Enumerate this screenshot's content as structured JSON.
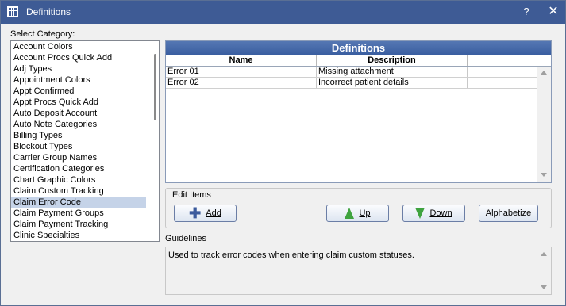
{
  "window": {
    "title": "Definitions",
    "help_label": "?",
    "close_label": "✕"
  },
  "categories": {
    "label": "Select Category:",
    "items": [
      "Account Colors",
      "Account Procs Quick Add",
      "Adj Types",
      "Appointment Colors",
      "Appt Confirmed",
      "Appt Procs Quick Add",
      "Auto Deposit Account",
      "Auto Note Categories",
      "Billing Types",
      "Blockout Types",
      "Carrier Group Names",
      "Certification Categories",
      "Chart Graphic Colors",
      "Claim Custom Tracking",
      "Claim Error Code",
      "Claim Payment Groups",
      "Claim Payment Tracking",
      "Clinic Specialties"
    ],
    "selected": "Claim Error Code"
  },
  "definitions": {
    "header": "Definitions",
    "columns": [
      "Name",
      "Description",
      "",
      ""
    ],
    "rows": [
      {
        "name": "Error 01",
        "description": "Missing attachment"
      },
      {
        "name": "Error 02",
        "description": "Incorrect patient details"
      }
    ]
  },
  "edit_items": {
    "title": "Edit Items",
    "add_label": "Add",
    "up_label": "Up",
    "down_label": "Down",
    "alphabetize_label": "Alphabetize"
  },
  "guidelines": {
    "label": "Guidelines",
    "text": "Used to track error codes when entering claim custom statuses."
  },
  "icons": {
    "app": "grid-app-icon",
    "add": "plus-icon",
    "up": "green-up-arrow-icon",
    "down": "green-down-arrow-icon"
  },
  "colors": {
    "titlebar": "#3e5b95",
    "header": "#3a5ea0",
    "selection": "#c5d3e8",
    "arrow": "#3fa33f"
  }
}
